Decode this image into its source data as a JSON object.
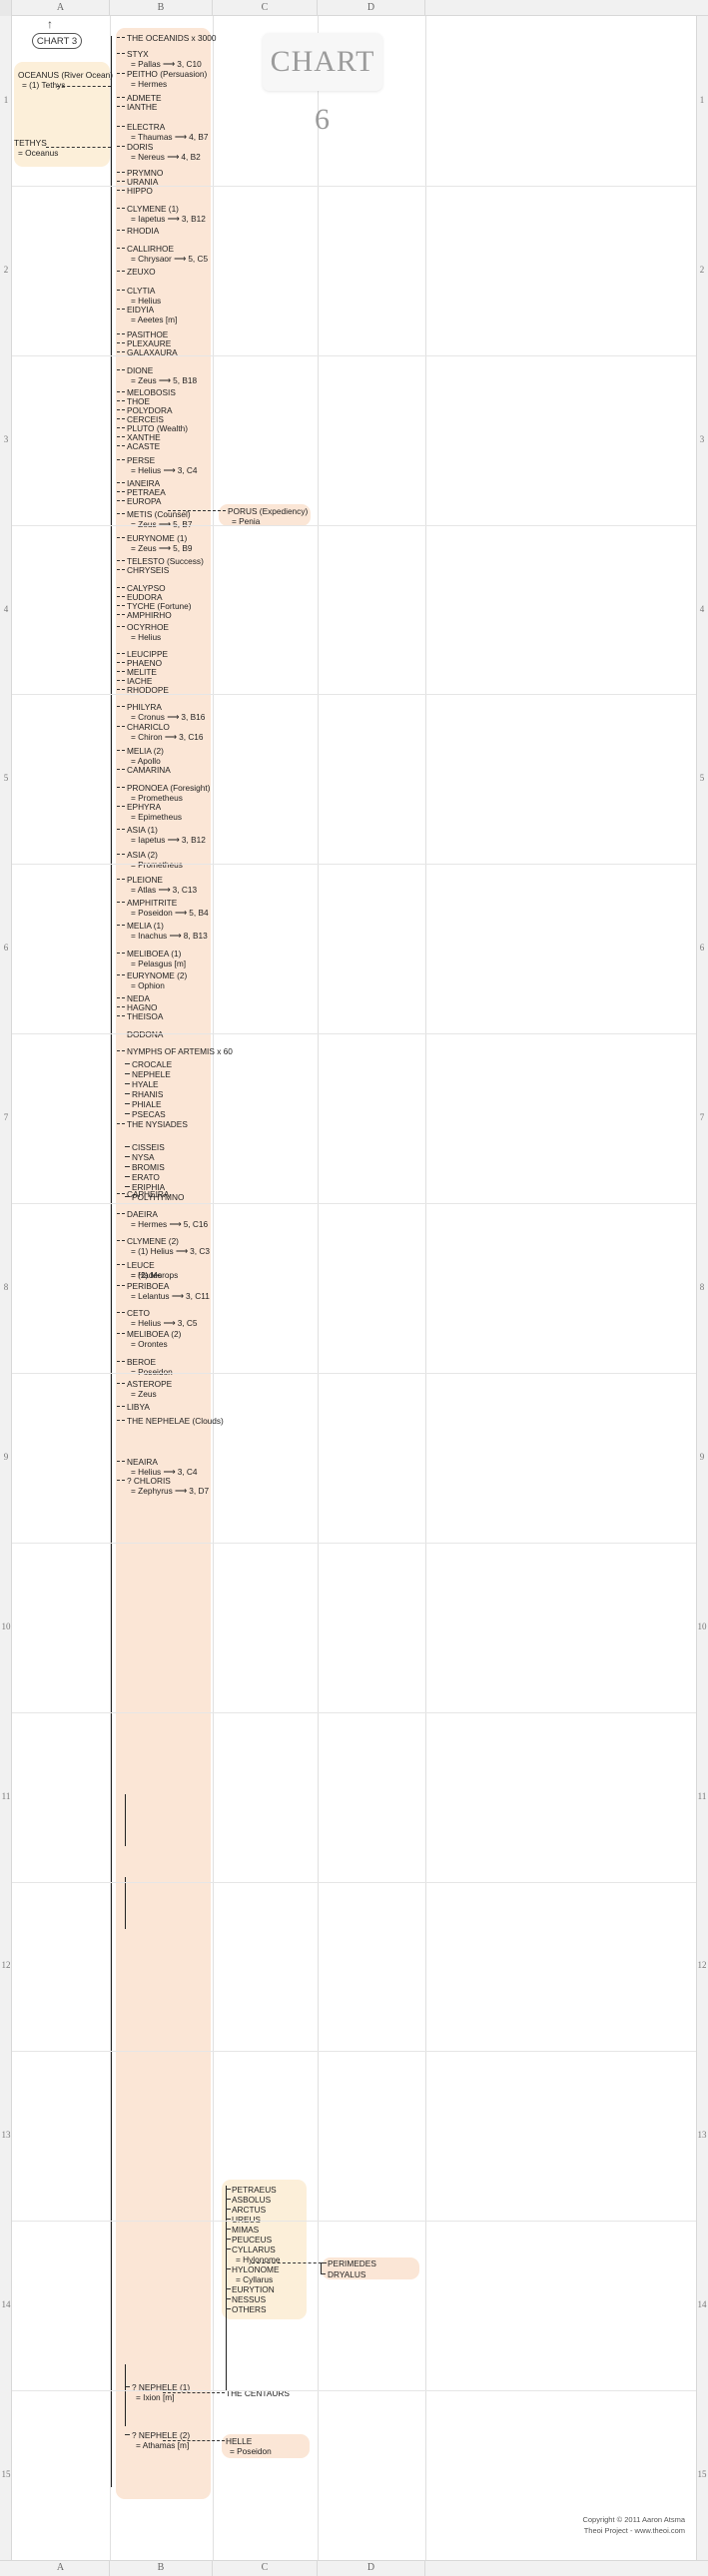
{
  "sheet": {
    "columns": [
      "A",
      "B",
      "C",
      "D"
    ],
    "rows": [
      "1",
      "2",
      "3",
      "4",
      "5",
      "6",
      "7",
      "8",
      "9",
      "10",
      "11",
      "12",
      "13",
      "14",
      "15"
    ]
  },
  "title": {
    "label": "CHART 6"
  },
  "chart_link": {
    "label": "CHART 3",
    "arrow": "↑"
  },
  "colA": {
    "oceanus": {
      "name": "OCEANUS (River Ocean)",
      "spouse": "=  (1) Tethys"
    },
    "tethys": {
      "name": "TETHYS",
      "spouse": "= Oceanus"
    }
  },
  "colB": {
    "entries": [
      {
        "name": "THE OCEANIDS x 3000",
        "sub": ""
      },
      {
        "name": "STYX",
        "sub": "= Pallas  ⟶  3, C10"
      },
      {
        "name": "PEITHO (Persuasion)",
        "sub": "= Hermes"
      },
      {
        "name": "ADMETE",
        "sub": ""
      },
      {
        "name": "IANTHE",
        "sub": ""
      },
      {
        "name": "ELECTRA",
        "sub": "= Thaumas  ⟶  4, B7"
      },
      {
        "name": "DORIS",
        "sub": "= Nereus  ⟶   4, B2"
      },
      {
        "name": "PRYMNO",
        "sub": ""
      },
      {
        "name": "URANIA",
        "sub": ""
      },
      {
        "name": "HIPPO",
        "sub": ""
      },
      {
        "name": "CLYMENE (1)",
        "sub": "= Iapetus  ⟶  3, B12"
      },
      {
        "name": "RHODIA",
        "sub": ""
      },
      {
        "name": "CALLIRHOE",
        "sub": "= Chrysaor  ⟶   5, C5"
      },
      {
        "name": "ZEUXO",
        "sub": ""
      },
      {
        "name": "CLYTIA",
        "sub": "= Helius"
      },
      {
        "name": "EIDYIA",
        "sub": "= Aeetes [m]"
      },
      {
        "name": "PASITHOE",
        "sub": ""
      },
      {
        "name": "PLEXAURE",
        "sub": ""
      },
      {
        "name": "GALAXAURA",
        "sub": ""
      },
      {
        "name": "DIONE",
        "sub": "= Zeus  ⟶  5, B18"
      },
      {
        "name": "MELOBOSIS",
        "sub": ""
      },
      {
        "name": "THOE",
        "sub": ""
      },
      {
        "name": "POLYDORA",
        "sub": ""
      },
      {
        "name": "CERCEIS",
        "sub": ""
      },
      {
        "name": "PLUTO (Wealth)",
        "sub": ""
      },
      {
        "name": "XANTHE",
        "sub": ""
      },
      {
        "name": "ACASTE",
        "sub": ""
      },
      {
        "name": "PERSE",
        "sub": "= Helius  ⟶   3, C4"
      },
      {
        "name": "IANEIRA",
        "sub": ""
      },
      {
        "name": "PETRAEA",
        "sub": ""
      },
      {
        "name": "EUROPA",
        "sub": ""
      },
      {
        "name": "METIS (Counsel)",
        "sub": "= Zeus  ⟶   5, B7"
      },
      {
        "name": "EURYNOME (1)",
        "sub": "= Zeus  ⟶  5, B9"
      },
      {
        "name": "TELESTO (Success)",
        "sub": ""
      },
      {
        "name": "CHRYSEIS",
        "sub": ""
      },
      {
        "name": "CALYPSO",
        "sub": ""
      },
      {
        "name": "EUDORA",
        "sub": ""
      },
      {
        "name": "TYCHE (Fortune)",
        "sub": ""
      },
      {
        "name": "AMPHIRHO",
        "sub": ""
      },
      {
        "name": "OCYRHOE",
        "sub": "= Helius"
      },
      {
        "name": "LEUCIPPE",
        "sub": ""
      },
      {
        "name": "PHAENO",
        "sub": ""
      },
      {
        "name": "MELITE",
        "sub": ""
      },
      {
        "name": "IACHE",
        "sub": ""
      },
      {
        "name": "RHODOPE",
        "sub": ""
      },
      {
        "name": "PHILYRA",
        "sub": "= Cronus  ⟶  3, B16"
      },
      {
        "name": "CHARICLO",
        "sub": "= Chiron  ⟶  3, C16"
      },
      {
        "name": "MELIA (2)",
        "sub": "= Apollo"
      },
      {
        "name": "CAMARINA",
        "sub": ""
      },
      {
        "name": "PRONOEA (Foresight)",
        "sub": "= Prometheus"
      },
      {
        "name": "EPHYRA",
        "sub": "= Epimetheus"
      },
      {
        "name": "ASIA (1)",
        "sub": "= Iapetus  ⟶  3, B12"
      },
      {
        "name": "ASIA (2)",
        "sub": "= Prometheus"
      },
      {
        "name": "PLEIONE",
        "sub": "= Atlas  ⟶  3, C13"
      },
      {
        "name": "AMPHITRITE",
        "sub": "= Poseidon  ⟶   5, B4"
      },
      {
        "name": "MELIA (1)",
        "sub": "= Inachus  ⟶  8, B13"
      },
      {
        "name": "MELIBOEA (1)",
        "sub": "= Pelasgus [m]"
      },
      {
        "name": "EURYNOME (2)",
        "sub": "= Ophion"
      },
      {
        "name": "NEDA",
        "sub": ""
      },
      {
        "name": "HAGNO",
        "sub": ""
      },
      {
        "name": "THEISOA",
        "sub": ""
      },
      {
        "name": "DODONA",
        "sub": ""
      },
      {
        "name": "NYMPHS OF ARTEMIS x 60",
        "sub": ""
      },
      {
        "name": "THE NYSIADES",
        "sub": ""
      },
      {
        "name": "CAPHEIRA",
        "sub": ""
      },
      {
        "name": "DAEIRA",
        "sub": "= Hermes  ⟶  5, C16"
      },
      {
        "name": "CLYMENE (2)",
        "sub": "= (1) Helius  ⟶  3, C3"
      },
      {
        "name": "LEUCE",
        "sub": "= Hades"
      },
      {
        "name": "PERIBOEA",
        "sub": "= Lelantus  ⟶  3, C11"
      },
      {
        "name": "CETO",
        "sub": "= Helius  ⟶  3, C5"
      },
      {
        "name": "MELIBOEA (2)",
        "sub": "= Orontes"
      },
      {
        "name": "BEROE",
        "sub": "= Poseidon"
      },
      {
        "name": "ASTEROPE",
        "sub": "= Zeus"
      },
      {
        "name": "LIBYA",
        "sub": ""
      },
      {
        "name": "THE NEPHELAE (Clouds)",
        "sub": ""
      },
      {
        "name": "NEAIRA",
        "sub": "= Helius  ⟶  3, C4"
      },
      {
        "name": "? CHLORIS",
        "sub": "= Zephyrus  ⟶  3, D7"
      }
    ],
    "artemis_nymphs": [
      "CROCALE",
      "NEPHELE",
      "HYALE",
      "RHANIS",
      "PHIALE",
      "PSECAS"
    ],
    "nysiades": [
      "CISSEIS",
      "NYSA",
      "BROMIS",
      "ERATO",
      "ERIPHIA",
      "POLYHYMNO"
    ],
    "clymene2_sub2": "= (2) Merops",
    "nephelae": [
      {
        "name": "? NEPHELE (1)",
        "sub": "= Ixion [m]"
      },
      {
        "name": "? NEPHELE (2)",
        "sub": "= Athamas [m]"
      }
    ]
  },
  "colC": {
    "porus": {
      "name": "PORUS (Expediency)",
      "sub": "= Penia"
    },
    "centaurs_label": "THE CENTAURS",
    "centaurs": [
      {
        "name": "PETRAEUS",
        "sub": ""
      },
      {
        "name": "ASBOLUS",
        "sub": ""
      },
      {
        "name": "ARCTUS",
        "sub": ""
      },
      {
        "name": "UREUS",
        "sub": ""
      },
      {
        "name": "MIMAS",
        "sub": ""
      },
      {
        "name": "PEUCEUS",
        "sub": ""
      },
      {
        "name": "CYLLARUS",
        "sub": "= Hylonome"
      },
      {
        "name": "HYLONOME",
        "sub": "= Cyllarus"
      },
      {
        "name": "EURYTION",
        "sub": ""
      },
      {
        "name": "NESSUS",
        "sub": ""
      },
      {
        "name": "OTHERS",
        "sub": ""
      }
    ],
    "helle": {
      "name": "HELLE",
      "sub": "= Poseidon"
    }
  },
  "colD": {
    "children": [
      "PERIMEDES",
      "DRYALUS"
    ]
  },
  "footer": {
    "line1": "Copyright © 2011 Aaron Atsma",
    "line2": "Theoi Project - www.theoi.com"
  },
  "colors": {
    "peach": "#fbe6d6",
    "cream": "#fcefd9",
    "header_gray": "#f1f1f1",
    "title_text": "#9b9b9b"
  }
}
